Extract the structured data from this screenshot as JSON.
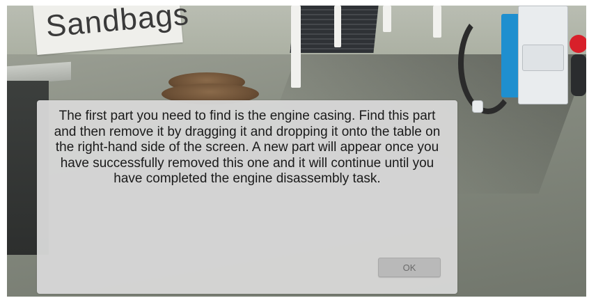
{
  "scene": {
    "sign_text": "Sandbags",
    "engine_accent_color": "#1f8fcf",
    "engine_highlight_color": "#d8202a"
  },
  "dialog": {
    "message": "The first part you need to find is the engine casing. Find this part and then remove it by dragging it and dropping it onto the table on the right-hand side of the screen. A new part will appear once you have successfully removed this one and it will continue until you have completed the engine disassembly task.",
    "ok_label": "OK"
  }
}
